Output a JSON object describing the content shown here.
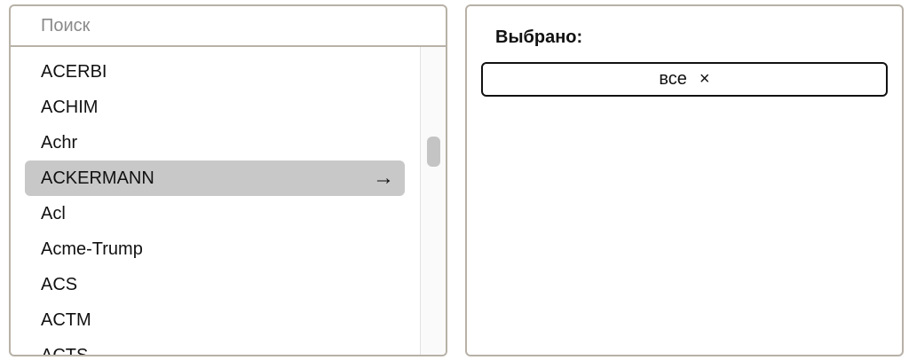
{
  "search": {
    "placeholder": "Поиск"
  },
  "list": {
    "items": [
      {
        "label": "ACERBI",
        "selected": false
      },
      {
        "label": "ACHIM",
        "selected": false
      },
      {
        "label": "Achr",
        "selected": false
      },
      {
        "label": "ACKERMANN",
        "selected": true
      },
      {
        "label": "Acl",
        "selected": false
      },
      {
        "label": "Acme-Trump",
        "selected": false
      },
      {
        "label": "ACS",
        "selected": false
      },
      {
        "label": "ACTM",
        "selected": false
      },
      {
        "label": "ACTS",
        "selected": false
      }
    ],
    "selected_arrow": "→"
  },
  "selection": {
    "title": "Выбрано:",
    "chip_label": "все",
    "chip_close": "×"
  },
  "colors": {
    "border": "#b7b1a7",
    "selected_bg": "#c8c8c8",
    "scroll_thumb": "#c4c4c4"
  }
}
